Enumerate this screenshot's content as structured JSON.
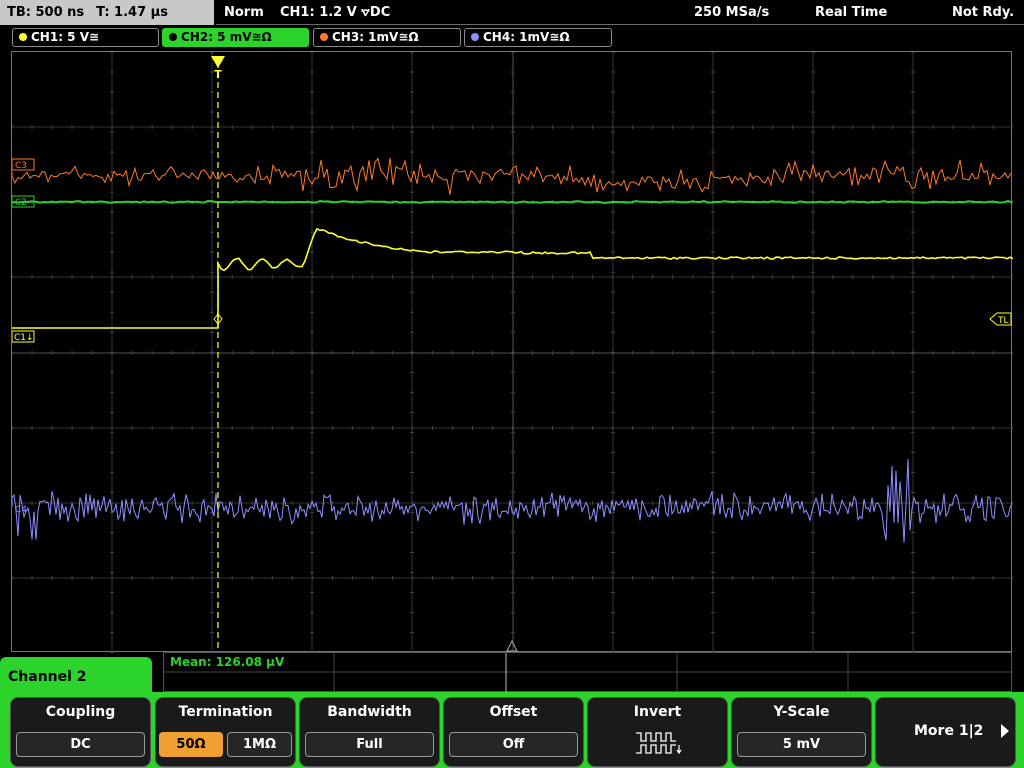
{
  "status": {
    "timebase": "TB: 500 ns",
    "trigger_time": "T: 1.47 µs",
    "mode": "Norm",
    "trigger": "CH1: 1.2 V ⦡DC",
    "sample_rate": "250 MSa/s",
    "acq_mode": "Real Time",
    "ready": "Not Rdy."
  },
  "channels": [
    {
      "label": "CH1: 5 V≅",
      "color": "#ffff30"
    },
    {
      "label": "CH2: 5 mV≅Ω",
      "color": "#2bd32b"
    },
    {
      "label": "CH3: 1mV≅Ω",
      "color": "#ff7a2a"
    },
    {
      "label": "CH4: 1mV≅Ω",
      "color": "#8f8fff"
    }
  ],
  "markers": {
    "ch3": "C3",
    "ch2": "C2",
    "ch1": "C1↓",
    "ch4": "C4",
    "trigger_level": "TL",
    "trigger_pos": "T"
  },
  "measurement": {
    "mean": "Mean: 126.08 µV"
  },
  "panel": {
    "channel_name": "Channel 2",
    "softkeys": [
      {
        "title": "Coupling",
        "value": "DC"
      },
      {
        "title": "Termination",
        "options": [
          "50Ω",
          "1MΩ"
        ],
        "selected": "50Ω"
      },
      {
        "title": "Bandwidth",
        "value": "Full"
      },
      {
        "title": "Offset",
        "value": "Off"
      },
      {
        "title": "Invert",
        "icon": "invert-waveform-icon"
      },
      {
        "title": "Y-Scale",
        "value": "5 mV"
      },
      {
        "title": "More 1|2",
        "icon": "arrow-right-icon"
      }
    ]
  }
}
